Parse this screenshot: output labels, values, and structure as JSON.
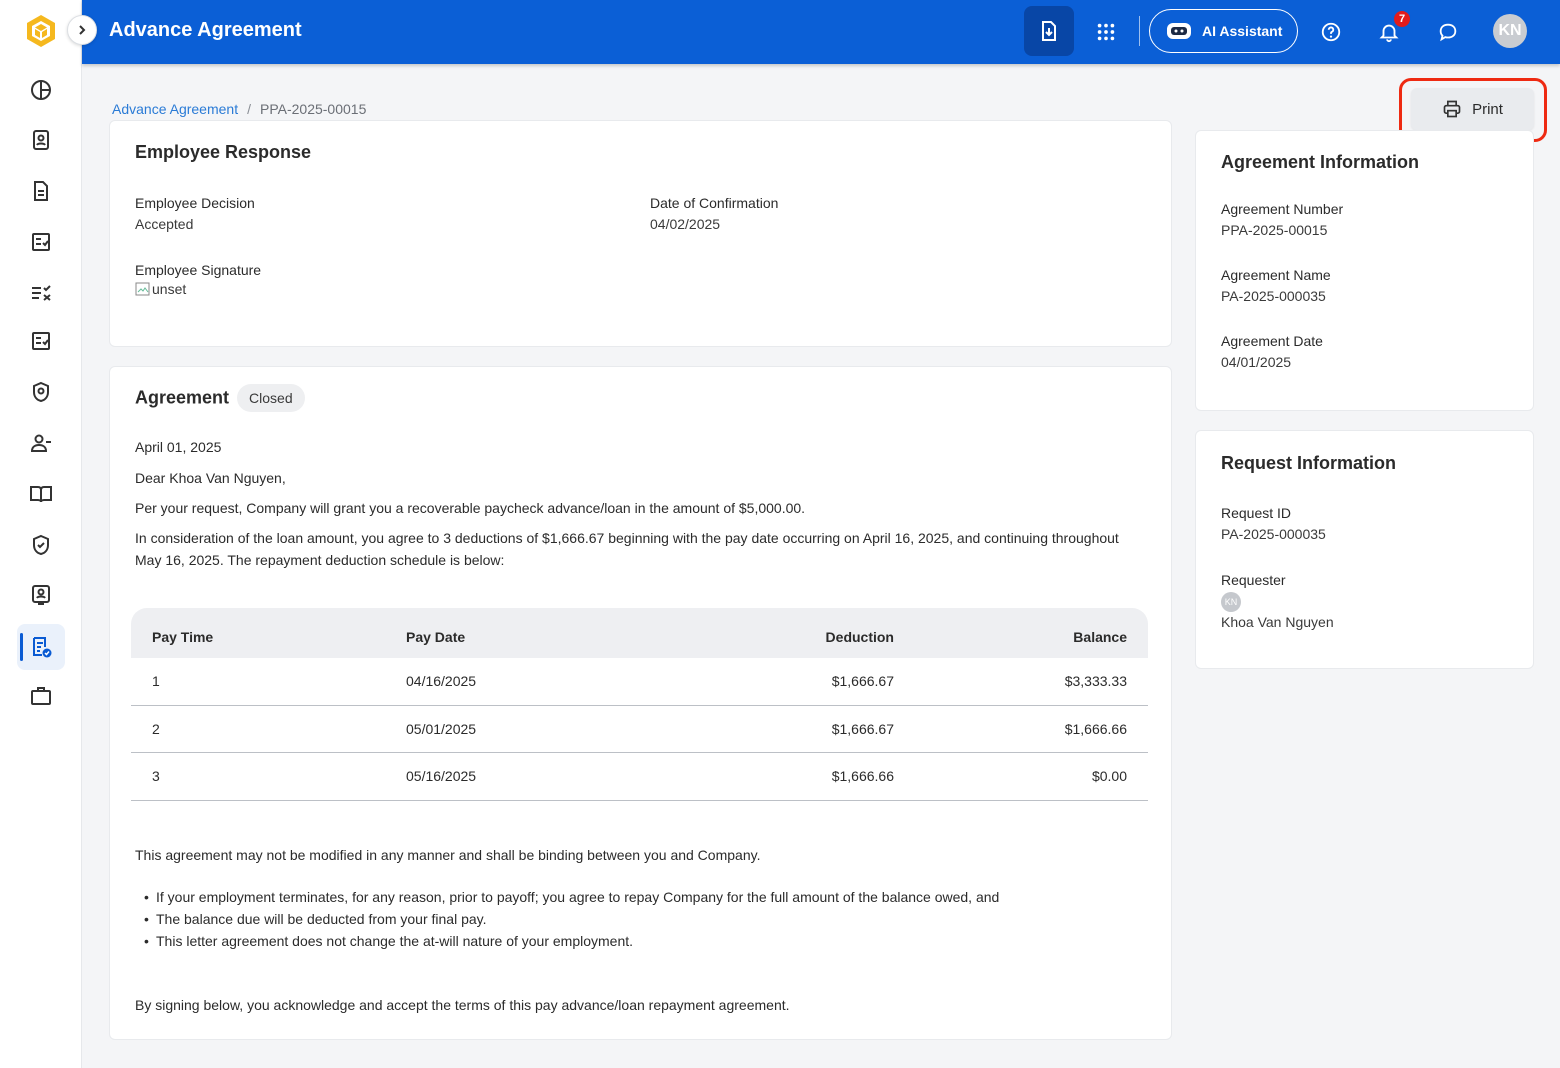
{
  "header": {
    "title": "Advance Agreement",
    "ai_assistant_label": "AI Assistant",
    "notification_count": "7",
    "user_initials": "KN",
    "brand_color": "#0b5fd6"
  },
  "sidebar": {
    "items": [
      {
        "icon": "chart-pie-icon"
      },
      {
        "icon": "profile-card-icon"
      },
      {
        "icon": "document-icon"
      },
      {
        "icon": "checklist-icon"
      },
      {
        "icon": "list-check-icon"
      },
      {
        "icon": "checklist-icon"
      },
      {
        "icon": "shield-user-icon"
      },
      {
        "icon": "user-minus-icon"
      },
      {
        "icon": "book-open-icon"
      },
      {
        "icon": "shield-check-icon"
      },
      {
        "icon": "badge-user-icon"
      },
      {
        "icon": "agreement-icon",
        "active": true
      },
      {
        "icon": "briefcase-icon"
      }
    ]
  },
  "breadcrumb": {
    "parent": "Advance Agreement",
    "current": "PPA-2025-00015"
  },
  "print_label": "Print",
  "employee_response": {
    "title": "Employee Response",
    "decision_label": "Employee Decision",
    "decision_value": "Accepted",
    "confirmation_label": "Date of Confirmation",
    "confirmation_value": "04/02/2025",
    "signature_label": "Employee Signature",
    "signature_alt": "unset"
  },
  "agreement": {
    "title": "Agreement",
    "status": "Closed",
    "date": "April 01, 2025",
    "greeting": "Dear Khoa Van Nguyen,",
    "paragraph1": "Per your request, Company will grant you a recoverable paycheck advance/loan in the amount of $5,000.00.",
    "paragraph2": "In consideration of the loan amount, you agree to 3 deductions of $1,666.67 beginning with the pay date occurring on April 16, 2025, and continuing throughout May 16, 2025. The repayment deduction schedule is below:",
    "schedule": {
      "headers": [
        "Pay Time",
        "Pay Date",
        "Deduction",
        "Balance"
      ],
      "rows": [
        [
          "1",
          "04/16/2025",
          "$1,666.67",
          "$3,333.33"
        ],
        [
          "2",
          "05/01/2025",
          "$1,666.67",
          "$1,666.66"
        ],
        [
          "3",
          "05/16/2025",
          "$1,666.66",
          "$0.00"
        ]
      ]
    },
    "terms_intro": "This agreement may not be modified in any manner and shall be binding between you and Company.",
    "bullets": [
      "If your employment terminates, for any reason, prior to payoff; you agree to repay Company for the full amount of the balance owed, and",
      "The balance due will be deducted from your final pay.",
      "This letter agreement does not change the at-will nature of your employment."
    ],
    "closing": "By signing below, you acknowledge and accept the terms of this pay advance/loan repayment agreement."
  },
  "agreement_info": {
    "title": "Agreement Information",
    "number_label": "Agreement Number",
    "number_value": "PPA-2025-00015",
    "name_label": "Agreement Name",
    "name_value": "PA-2025-000035",
    "date_label": "Agreement Date",
    "date_value": "04/01/2025"
  },
  "request_info": {
    "title": "Request Information",
    "id_label": "Request ID",
    "id_value": "PA-2025-000035",
    "requester_label": "Requester",
    "requester_initials": "KN",
    "requester_name": "Khoa Van Nguyen"
  }
}
